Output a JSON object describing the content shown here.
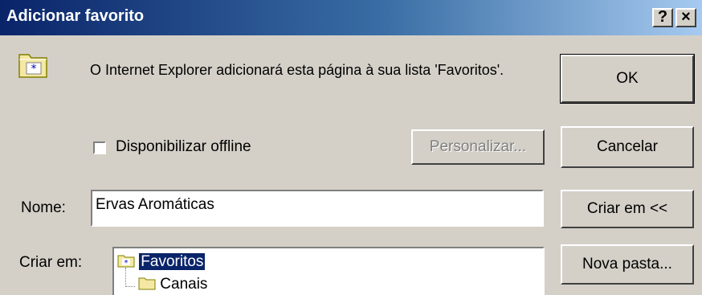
{
  "window": {
    "title": "Adicionar favorito",
    "help_button": "?",
    "close_button": "×"
  },
  "message": "O Internet Explorer adicionará esta página à sua lista 'Favoritos'.",
  "buttons": {
    "ok": "OK",
    "cancel": "Cancelar",
    "customize": "Personalizar...",
    "create_in": "Criar em <<",
    "new_folder": "Nova pasta..."
  },
  "offline": {
    "label": "Disponibilizar offline",
    "checked": false
  },
  "name_field": {
    "label": "Nome:",
    "value": "Ervas Aromáticas"
  },
  "create_in_label": "Criar em:",
  "tree": {
    "items": [
      "Favoritos",
      "Canais"
    ],
    "selected": "Favoritos"
  },
  "colors": {
    "title_gradient_start": "#0a246a",
    "title_gradient_end": "#a6caf0",
    "face": "#d4d0c8",
    "selection": "#0a246a",
    "folder": "#f4e8a4"
  },
  "icons": [
    "favorites-folder-icon",
    "help-icon",
    "close-icon",
    "folder-icon"
  ]
}
